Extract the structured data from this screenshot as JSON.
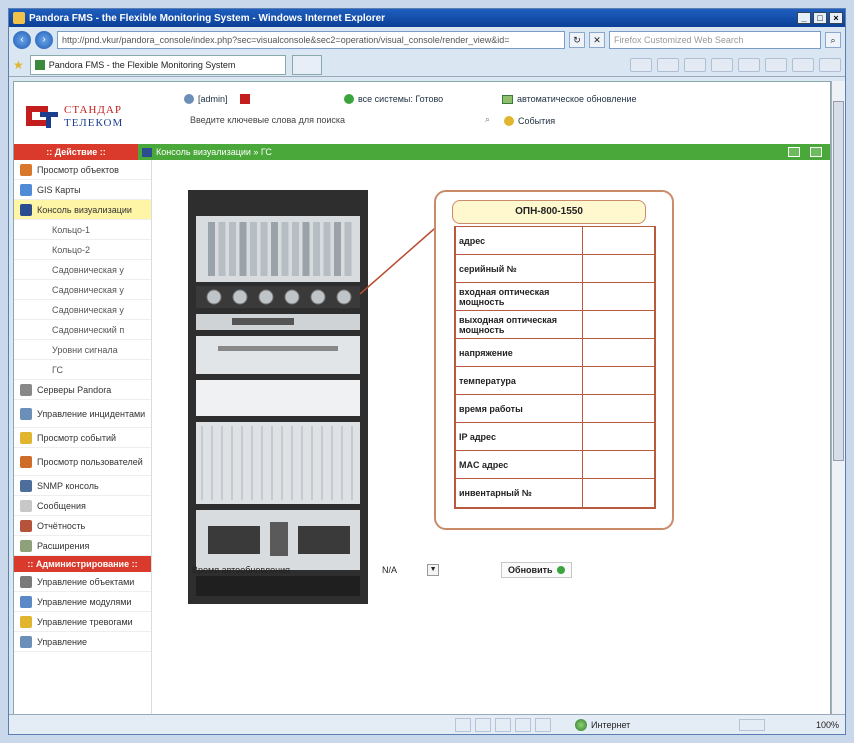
{
  "window": {
    "title": "Pandora FMS - the Flexible Monitoring System - Windows Internet Explorer",
    "controls": [
      "_",
      "□",
      "×"
    ]
  },
  "browser": {
    "address": "http://pnd.vkur/pandora_console/index.php?sec=visualconsole&sec2=operation/visual_console/render_view&id=",
    "search_placeholder": "Firefox Customized Web Search",
    "tab_title": "Pandora FMS - the Flexible Monitoring System"
  },
  "header": {
    "logo_line1": "СТАНДАР",
    "logo_line2": "ТЕЛЕКОМ",
    "user": "[admin]",
    "search_placeholder": "Введите ключевые слова для поиска",
    "status": "все системы: Готово",
    "autorefresh": "автоматическое обновление",
    "events": "События"
  },
  "nav": {
    "action_header": ":: Действие ::",
    "breadcrumb": "Консоль визуализации » ГС",
    "items": [
      {
        "label": "Просмотр объектов",
        "icon": "magnifier-icon",
        "color": "#d9772b"
      },
      {
        "label": "GIS Карты",
        "icon": "globe-icon",
        "color": "#4f8bd6"
      },
      {
        "label": "Консоль визуализации",
        "icon": "monitor-icon",
        "color": "#2b4d8f",
        "active": true
      },
      {
        "label": "Кольцо-1",
        "sub": true
      },
      {
        "label": "Кольцо-2",
        "sub": true
      },
      {
        "label": "Садовническая у",
        "sub": true
      },
      {
        "label": "Садовническая у",
        "sub": true
      },
      {
        "label": "Садовническая у",
        "sub": true
      },
      {
        "label": "Садовнический п",
        "sub": true
      },
      {
        "label": "Уровни сигнала",
        "sub": true
      },
      {
        "label": "ГС",
        "sub": true
      },
      {
        "label": "Серверы Pandora",
        "icon": "server-icon",
        "color": "#888888"
      },
      {
        "label": "Управление инцидентами",
        "icon": "incident-icon",
        "color": "#6b8fb8",
        "tall": true
      },
      {
        "label": "Просмотр событий",
        "icon": "events-icon",
        "color": "#e2b52f"
      },
      {
        "label": "Просмотр пользователей",
        "icon": "users-icon",
        "color": "#d06c2a",
        "tall": true
      },
      {
        "label": "SNMP консоль",
        "icon": "snmp-icon",
        "color": "#4d6d9a"
      },
      {
        "label": "Сообщения",
        "icon": "mail-icon",
        "color": "#c8c8c8"
      },
      {
        "label": "Отчётность",
        "icon": "report-icon",
        "color": "#b5543a"
      },
      {
        "label": "Расширения",
        "icon": "extension-icon",
        "color": "#8fa17b"
      }
    ],
    "admin_header": ":: Администрирование ::",
    "admin_items": [
      {
        "label": "Управление объектами",
        "icon": "manage-agents-icon",
        "color": "#7a7a7a"
      },
      {
        "label": "Управление модулями",
        "icon": "modules-icon",
        "color": "#5b88c6"
      },
      {
        "label": "Управление тревогами",
        "icon": "alerts-icon",
        "color": "#e2b52f"
      },
      {
        "label": "Управление",
        "icon": "manage-users-icon",
        "color": "#6b8fb8"
      }
    ]
  },
  "device": {
    "title": "ОПН-800-1550",
    "fields": [
      "адрес",
      "серийный №",
      "входная оптическая мощность",
      "выходная оптическая мощность",
      "напряжение",
      "температура",
      "время работы",
      "IP адрес",
      "MAC адрес",
      "инвентарный №"
    ]
  },
  "refresh": {
    "label": "Время автообновления",
    "value": "N/A",
    "button": "Обновить"
  },
  "statusbar": {
    "zone": "Интернет",
    "zoom": "100%"
  }
}
